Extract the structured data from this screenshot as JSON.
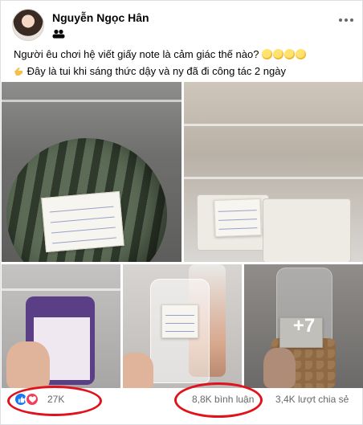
{
  "post": {
    "author_name": "Nguyễn Ngọc Hân",
    "privacy_icon": "friends-icon",
    "caption_line1": "Người êu chơi hệ viết giấy note là cảm giác thế nào? ",
    "caption_line2": "Đây là tui khi sáng thức dậy và ny đã đi công tác 2 ngày",
    "photos_more_count": "+7"
  },
  "stats": {
    "reactions": "27K",
    "comments": "8,8K bình luận",
    "shares": "3,4K lượt chia sẻ"
  },
  "colors": {
    "like_blue": "#1877f2",
    "love_red": "#f33e58",
    "annotation_red": "#e0121c",
    "meta_gray": "#65676b"
  }
}
